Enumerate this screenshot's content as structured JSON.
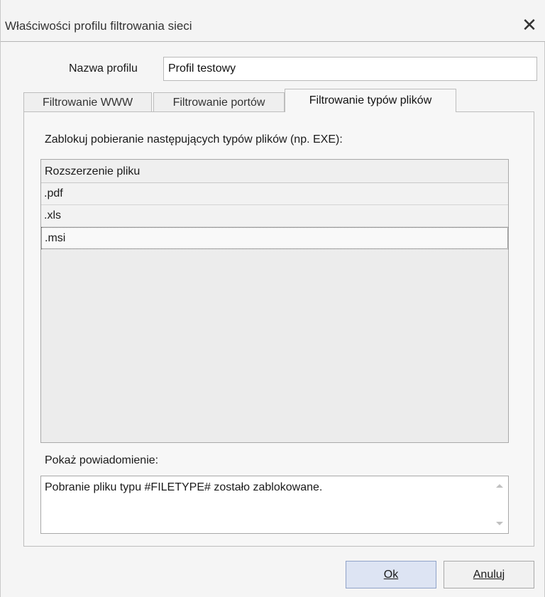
{
  "dialog": {
    "title": "Właściwości profilu filtrowania sieci",
    "close_icon": "close-icon"
  },
  "profile": {
    "label": "Nazwa profilu",
    "value": "Profil testowy"
  },
  "tabs": [
    {
      "label": "Filtrowanie WWW",
      "active": false
    },
    {
      "label": "Filtrowanie portów",
      "active": false
    },
    {
      "label": "Filtrowanie typów plików",
      "active": true
    }
  ],
  "filetypes": {
    "instruction": "Zablokuj pobieranie następujących typów plików (np. EXE):",
    "column_header": "Rozszerzenie pliku",
    "rows": [
      ".pdf",
      ".xls",
      ".msi"
    ],
    "selected_row": ".msi"
  },
  "notification": {
    "label": "Pokaż powiadomienie:",
    "text": "Pobranie pliku typu #FILETYPE# zostało zablokowane."
  },
  "buttons": {
    "ok_label": "Ok",
    "cancel_label": "Anuluj"
  }
}
